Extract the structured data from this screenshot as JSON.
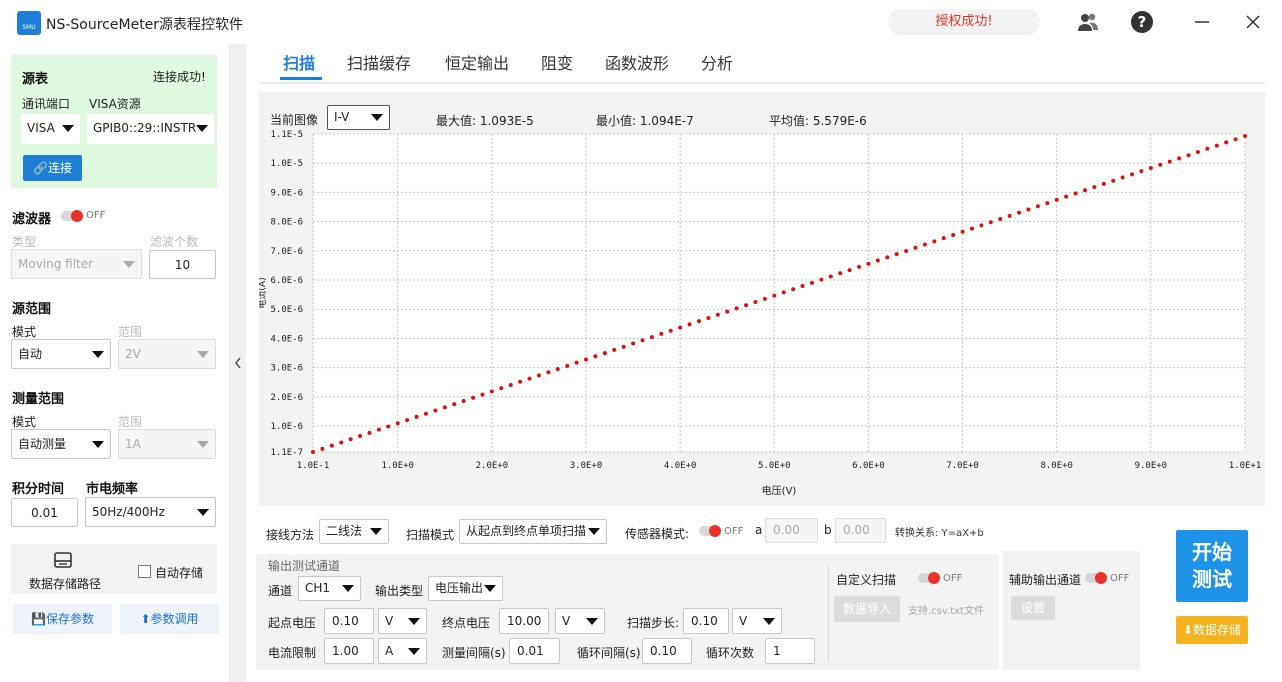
{
  "app": {
    "title": "NS-SourceMeter源表程控软件",
    "logo_text": "SMU",
    "auth_status": "授权成功!"
  },
  "titlebar": {
    "icons": [
      "user-group-icon",
      "help-icon",
      "minimize-icon",
      "close-icon"
    ]
  },
  "source": {
    "title": "源表",
    "status": "连接成功!",
    "port_label": "通讯端口",
    "port_value": "VISA",
    "visa_label": "VISA资源",
    "visa_value": "GPIB0::29::INSTR",
    "connect_label": "连接"
  },
  "filter": {
    "title": "滤波器",
    "toggle": "OFF",
    "type_label": "类型",
    "type_value": "Moving filter",
    "count_label": "滤波个数",
    "count_value": "10"
  },
  "source_range": {
    "title": "源范围",
    "mode_label": "模式",
    "mode_value": "自动",
    "range_label": "范围",
    "range_value": "2V"
  },
  "measure_range": {
    "title": "测量范围",
    "mode_label": "模式",
    "mode_value": "自动测量",
    "range_label": "范围",
    "range_value": "1A"
  },
  "integration": {
    "title": "积分时间",
    "value": "0.01",
    "freq_title": "市电频率",
    "freq_value": "50Hz/400Hz"
  },
  "storage": {
    "path_label": "数据存储路径",
    "auto_label": "自动存储",
    "save_params": "保存参数",
    "load_params": "参数调用"
  },
  "tabs": [
    "扫描",
    "扫描缓存",
    "恒定输出",
    "阻变",
    "函数波形",
    "分析"
  ],
  "stats": {
    "image_label": "当前图像",
    "image_value": "I-V",
    "max": "最大值: 1.093E-5",
    "min": "最小值: 1.094E-7",
    "avg": "平均值: 5.579E-6"
  },
  "chart_data": {
    "type": "scatter",
    "xlabel": "电压(V)",
    "ylabel": "电流(A)",
    "xlim": [
      0.1,
      10
    ],
    "ylim": [
      1.1e-07,
      1.1e-05
    ],
    "x_ticks": [
      "1.0E-1",
      "1.0E+0",
      "2.0E+0",
      "3.0E+0",
      "4.0E+0",
      "5.0E+0",
      "6.0E+0",
      "7.0E+0",
      "8.0E+0",
      "9.0E+0",
      "1.0E+1"
    ],
    "y_ticks": [
      "1.1E-7",
      "1.0E-6",
      "2.0E-6",
      "3.0E-6",
      "4.0E-6",
      "5.0E-6",
      "6.0E-6",
      "7.0E-6",
      "8.0E-6",
      "9.0E-6",
      "1.0E-5",
      "1.1E-5"
    ],
    "grid": true,
    "series_color": "#e01010",
    "x_start": 0.1,
    "x_end": 10,
    "x_step": 0.1,
    "y_start": 1.094e-07,
    "y_end": 1.093e-05
  },
  "wiring": {
    "method_label": "接线方法",
    "method_value": "二线法",
    "scan_mode_label": "扫描模式",
    "scan_mode_value": "从起点到终点单项扫描",
    "sensor_label": "传感器模式:",
    "sensor_toggle": "OFF",
    "a_label": "a",
    "a_value": "0.00",
    "b_label": "b",
    "b_value": "0.00",
    "relation": "转换关系: Y=aX+b"
  },
  "output": {
    "group_title": "输出测试通道",
    "channel_label": "通道",
    "channel_value": "CH1",
    "type_label": "输出类型",
    "type_value": "电压输出",
    "start_label": "起点电压",
    "start_value": "0.10",
    "start_unit": "V",
    "end_label": "终点电压",
    "end_value": "10.00",
    "end_unit": "V",
    "step_label": "扫描步长:",
    "step_value": "0.10",
    "step_unit": "V",
    "limit_label": "电流限制",
    "limit_value": "1.00",
    "limit_unit": "A",
    "interval_label": "测量间隔(s)",
    "interval_value": "0.01",
    "loop_interval_label": "循环间隔(s)",
    "loop_interval_value": "0.10",
    "loop_count_label": "循环次数",
    "loop_count_value": "1"
  },
  "custom_scan": {
    "label": "自定义扫描",
    "toggle": "OFF",
    "import_label": "数据导入",
    "hint": "支持.csv.txt文件"
  },
  "aux": {
    "label": "辅助输出通道",
    "toggle": "OFF",
    "settings_label": "设置"
  },
  "actions": {
    "start_label_line1": "开始",
    "start_label_line2": "测试",
    "save_data_label": "数据存储"
  }
}
